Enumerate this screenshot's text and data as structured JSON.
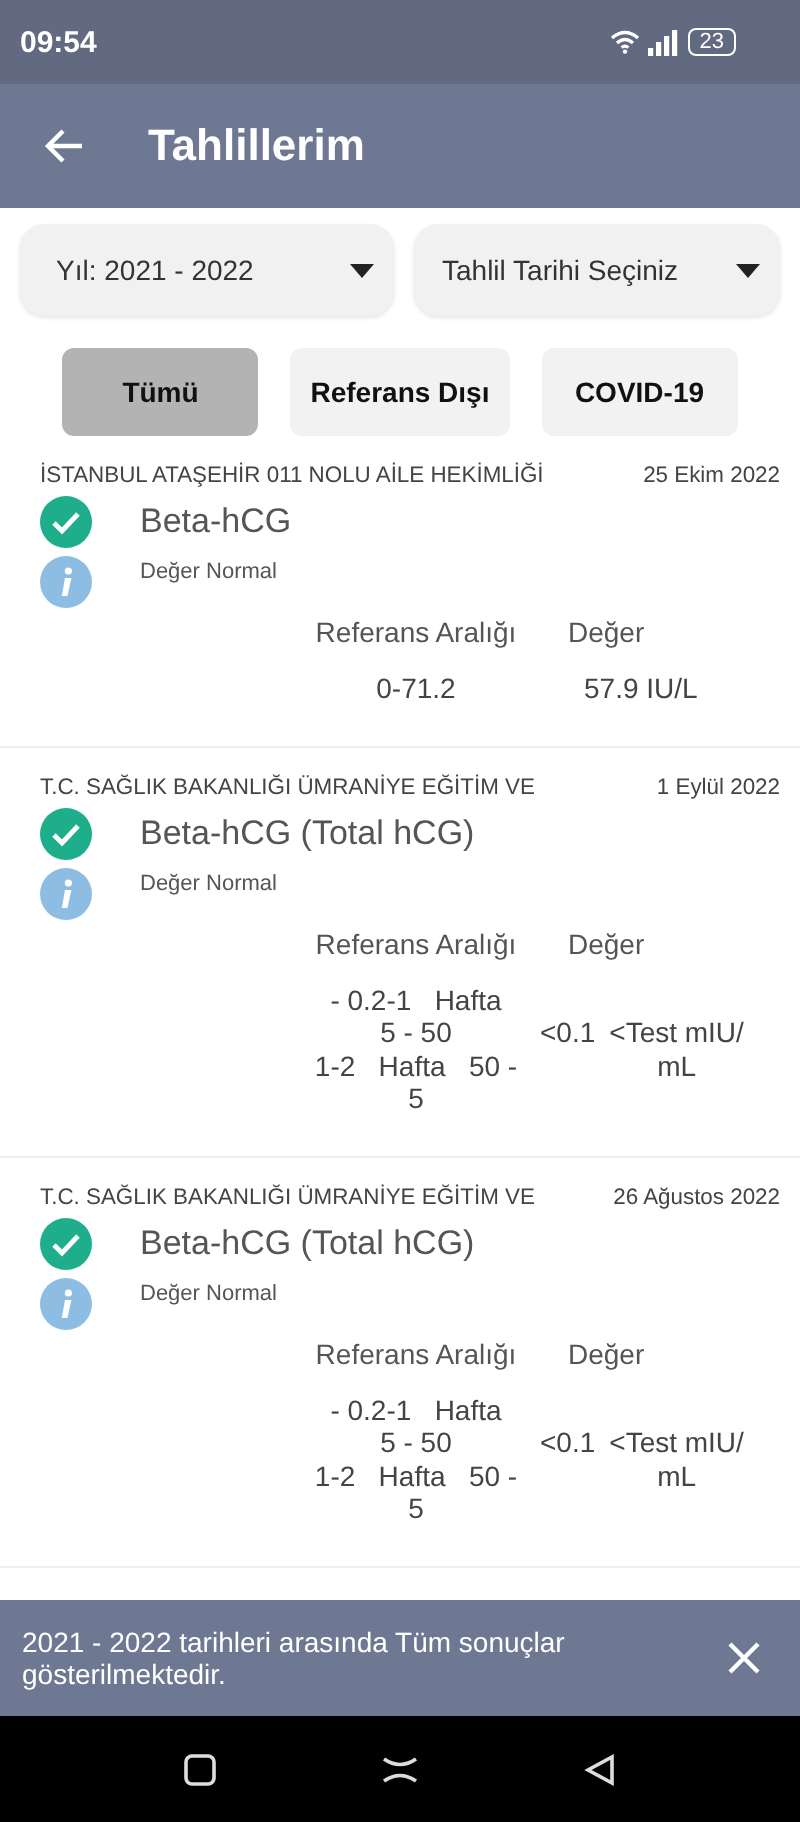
{
  "status_bar": {
    "time": "09:54",
    "battery": "23"
  },
  "header": {
    "title": "Tahlillerim"
  },
  "filters": [
    {
      "label": "Yıl: 2021 - 2022"
    },
    {
      "label": "Tahlil Tarihi Seçiniz"
    }
  ],
  "tabs": [
    {
      "label": "Tümü",
      "selected": true
    },
    {
      "label": "Referans Dışı",
      "selected": false
    },
    {
      "label": "COVID-19",
      "selected": false
    }
  ],
  "results": [
    {
      "institution": "İSTANBUL ATAŞEHİR 011 NOLU AİLE HEKİMLİĞİ",
      "date": "25 Ekim 2022",
      "test": "Beta-hCG",
      "status": "Değer Normal",
      "reference_header": "Referans Aralığı",
      "value_header": "Değer",
      "reference_lines": [
        "0-71.2"
      ],
      "value": "57.9 IU/L"
    },
    {
      "institution": "T.C. SAĞLIK BAKANLIĞI ÜMRANİYE EĞİTİM VE",
      "date": "1 Eylül 2022",
      "test": "Beta-hCG (Total hCG)",
      "status": "Değer Normal",
      "reference_header": "Referans Aralığı",
      "value_header": "Değer",
      "reference_lines": [
        "- 0.2-1   Hafta",
        "5 - 50",
        "1-2   Hafta   50 -",
        "5"
      ],
      "value": "<0.1",
      "unit_lines": [
        "<Test mIU/",
        "mL"
      ]
    },
    {
      "institution": "T.C. SAĞLIK BAKANLIĞI ÜMRANİYE EĞİTİM VE",
      "date": "26 Ağustos 2022",
      "test": "Beta-hCG (Total hCG)",
      "status": "Değer Normal",
      "reference_header": "Referans Aralığı",
      "value_header": "Değer",
      "reference_lines": [
        "- 0.2-1   Hafta",
        "5 - 50",
        "1-2   Hafta   50 -",
        "5"
      ],
      "value": "<0.1",
      "unit_lines": [
        "<Test mIU/",
        "mL"
      ]
    }
  ],
  "banner": {
    "message": "2021 - 2022 tarihleri arasında Tüm sonuçlar gösterilmektedir."
  }
}
